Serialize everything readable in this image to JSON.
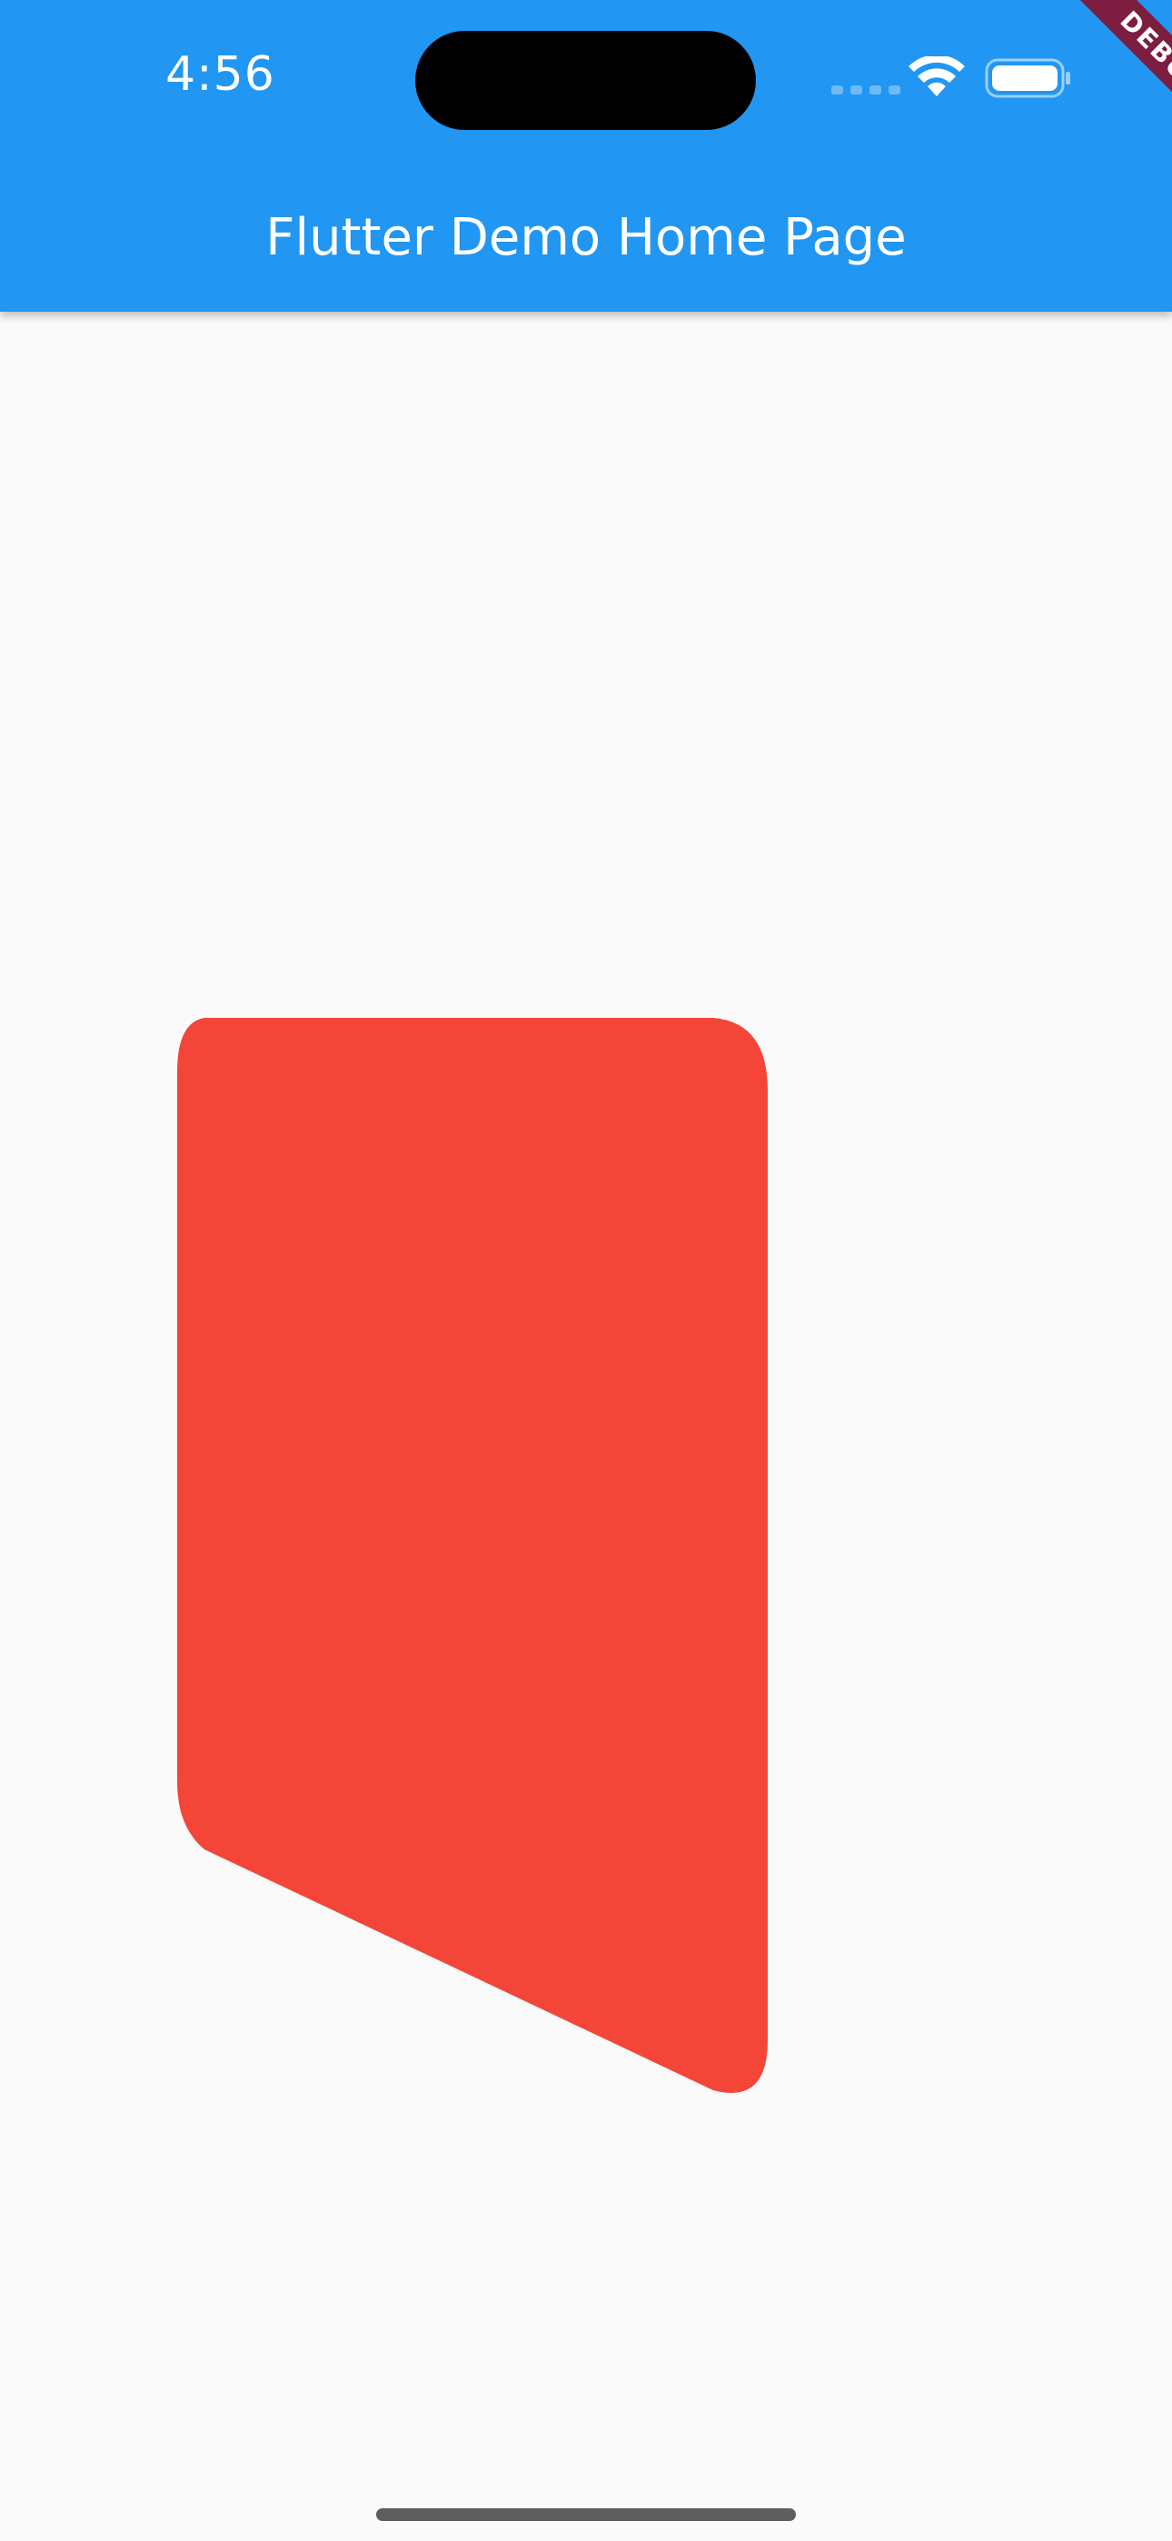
{
  "status_bar": {
    "time": "4:56"
  },
  "app_bar": {
    "title": "Flutter Demo Home Page"
  },
  "debug_banner": {
    "label": "DEBUG"
  },
  "colors": {
    "app_bar": "#2196f3",
    "background": "#fafafa",
    "shape": "#f44539",
    "debug_banner": "#7d1d3f"
  },
  "icons": [
    "wifi-icon",
    "battery-icon"
  ]
}
